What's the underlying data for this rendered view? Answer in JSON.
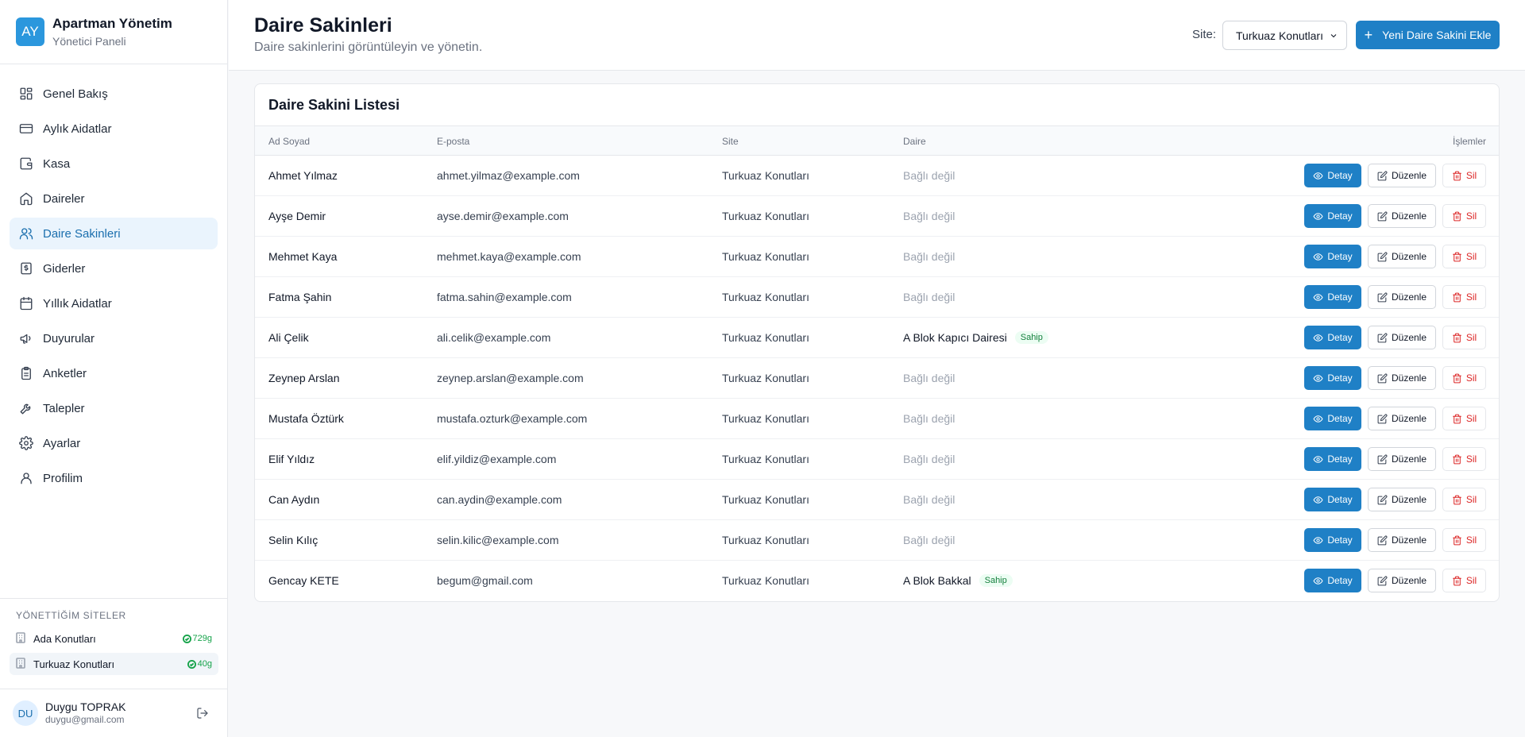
{
  "brand": {
    "initials": "AY",
    "title": "Apartman Yönetim",
    "subtitle": "Yönetici Paneli"
  },
  "nav": [
    {
      "label": "Genel Bakış",
      "icon": "grid-icon",
      "active": false
    },
    {
      "label": "Aylık Aidatlar",
      "icon": "credit-card-icon",
      "active": false
    },
    {
      "label": "Kasa",
      "icon": "wallet-icon",
      "active": false
    },
    {
      "label": "Daireler",
      "icon": "home-icon",
      "active": false
    },
    {
      "label": "Daire Sakinleri",
      "icon": "users-icon",
      "active": true
    },
    {
      "label": "Giderler",
      "icon": "receipt-icon",
      "active": false
    },
    {
      "label": "Yıllık Aidatlar",
      "icon": "calendar-icon",
      "active": false
    },
    {
      "label": "Duyurular",
      "icon": "megaphone-icon",
      "active": false
    },
    {
      "label": "Anketler",
      "icon": "clipboard-icon",
      "active": false
    },
    {
      "label": "Talepler",
      "icon": "wrench-icon",
      "active": false
    },
    {
      "label": "Ayarlar",
      "icon": "gear-icon",
      "active": false
    },
    {
      "label": "Profilim",
      "icon": "user-icon",
      "active": false
    }
  ],
  "sites": {
    "heading": "YÖNETTİĞİM SİTELER",
    "items": [
      {
        "name": "Ada Konutları",
        "badge": "729g",
        "active": false
      },
      {
        "name": "Turkuaz Konutları",
        "badge": "40g",
        "active": true
      }
    ]
  },
  "user": {
    "initials": "DU",
    "name": "Duygu TOPRAK",
    "email": "duygu@gmail.com"
  },
  "header": {
    "title": "Daire Sakinleri",
    "subtitle": "Daire sakinlerini görüntüleyin ve yönetin.",
    "site_label": "Site:",
    "site_selected": "Turkuaz Konutları",
    "add_button": "Yeni Daire Sakini Ekle"
  },
  "table": {
    "title": "Daire Sakini Listesi",
    "columns": {
      "name": "Ad Soyad",
      "email": "E-posta",
      "site": "Site",
      "flat": "Daire",
      "actions": "İşlemler"
    },
    "actions": {
      "detail": "Detay",
      "edit": "Düzenle",
      "delete": "Sil"
    },
    "rows": [
      {
        "name": "Ahmet Yılmaz",
        "email": "ahmet.yilmaz@example.com",
        "site": "Turkuaz Konutları",
        "flat": "Bağlı değil",
        "linked": false,
        "badge": ""
      },
      {
        "name": "Ayşe Demir",
        "email": "ayse.demir@example.com",
        "site": "Turkuaz Konutları",
        "flat": "Bağlı değil",
        "linked": false,
        "badge": ""
      },
      {
        "name": "Mehmet Kaya",
        "email": "mehmet.kaya@example.com",
        "site": "Turkuaz Konutları",
        "flat": "Bağlı değil",
        "linked": false,
        "badge": ""
      },
      {
        "name": "Fatma Şahin",
        "email": "fatma.sahin@example.com",
        "site": "Turkuaz Konutları",
        "flat": "Bağlı değil",
        "linked": false,
        "badge": ""
      },
      {
        "name": "Ali Çelik",
        "email": "ali.celik@example.com",
        "site": "Turkuaz Konutları",
        "flat": "A Blok Kapıcı Dairesi",
        "linked": true,
        "badge": "Sahip"
      },
      {
        "name": "Zeynep Arslan",
        "email": "zeynep.arslan@example.com",
        "site": "Turkuaz Konutları",
        "flat": "Bağlı değil",
        "linked": false,
        "badge": ""
      },
      {
        "name": "Mustafa Öztürk",
        "email": "mustafa.ozturk@example.com",
        "site": "Turkuaz Konutları",
        "flat": "Bağlı değil",
        "linked": false,
        "badge": ""
      },
      {
        "name": "Elif Yıldız",
        "email": "elif.yildiz@example.com",
        "site": "Turkuaz Konutları",
        "flat": "Bağlı değil",
        "linked": false,
        "badge": ""
      },
      {
        "name": "Can Aydın",
        "email": "can.aydin@example.com",
        "site": "Turkuaz Konutları",
        "flat": "Bağlı değil",
        "linked": false,
        "badge": ""
      },
      {
        "name": "Selin Kılıç",
        "email": "selin.kilic@example.com",
        "site": "Turkuaz Konutları",
        "flat": "Bağlı değil",
        "linked": false,
        "badge": ""
      },
      {
        "name": "Gencay KETE",
        "email": "begum@gmail.com",
        "site": "Turkuaz Konutları",
        "flat": "A Blok Bakkal",
        "linked": true,
        "badge": "Sahip"
      }
    ]
  },
  "colors": {
    "primary": "#1f80c6",
    "active_bg": "#eaf4fd",
    "danger": "#dc2626",
    "success": "#15803d"
  }
}
